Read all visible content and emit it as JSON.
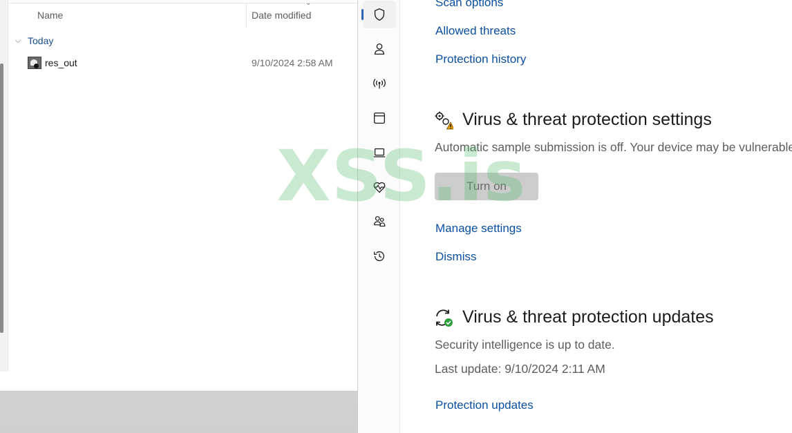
{
  "explorer": {
    "columns": {
      "name": "Name",
      "date_modified": "Date modified"
    },
    "group": {
      "label": "Today"
    },
    "file": {
      "name": "res_out",
      "date": "9/10/2024 2:58 AM"
    }
  },
  "security": {
    "nav_items": [
      "shield-icon",
      "account-icon",
      "network-icon",
      "app-browser-icon",
      "device-security-icon",
      "device-health-icon",
      "family-options-icon",
      "history-icon"
    ],
    "active_nav": "shield-icon",
    "links_top": {
      "scan_options": "Scan options",
      "allowed_threats": "Allowed threats",
      "protection_history": "Protection history"
    },
    "settings_section": {
      "title": "Virus & threat protection settings",
      "description": "Automatic sample submission is off. Your device may be vulnerable.",
      "turn_on_label": "Turn on",
      "manage_link": "Manage settings",
      "dismiss_link": "Dismiss"
    },
    "updates_section": {
      "title": "Virus & threat protection updates",
      "status": "Security intelligence is up to date.",
      "last_update": "Last update: 9/10/2024 2:11 AM",
      "updates_link": "Protection updates"
    }
  },
  "watermark": {
    "text": "XSS.is"
  },
  "colors": {
    "link": "#0b4fa0",
    "accent": "#2f63b5",
    "watermark": "#56be6c"
  }
}
